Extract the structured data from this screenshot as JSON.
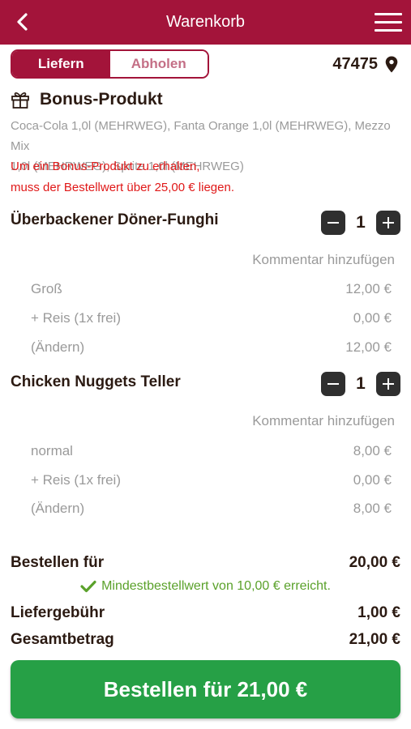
{
  "header": {
    "title": "Warenkorb"
  },
  "tabs": {
    "deliver": "Liefern",
    "pickup": "Abholen"
  },
  "location": {
    "zip": "47475"
  },
  "bonus": {
    "title": "Bonus-Produkt",
    "products_line1": "Coca-Cola 1,0l (MEHRWEG), Fanta Orange 1,0l (MEHRWEG), Mezzo Mix",
    "products_line2": "1,0l (MEHRWEG), Sprite 1,0l (MEHRWEG)",
    "note_line1": "Um ein Bonus-Produkt zu erhalten,",
    "note_line2": "muss der Bestellwert über 25,00 € liegen."
  },
  "items": [
    {
      "name": "Überbackener Döner-Funghi",
      "quantity": "1",
      "comment": "Kommentar hinzufügen",
      "rows": [
        {
          "label": "Groß",
          "price": "12,00 €"
        },
        {
          "label": "+ Reis (1x frei)",
          "price": "0,00 €"
        },
        {
          "label": "(Ändern)",
          "price": "12,00 €"
        }
      ]
    },
    {
      "name": "Chicken Nuggets Teller",
      "quantity": "1",
      "comment": "Kommentar hinzufügen",
      "rows": [
        {
          "label": "normal",
          "price": "8,00 €"
        },
        {
          "label": "+ Reis (1x frei)",
          "price": "0,00 €"
        },
        {
          "label": "(Ändern)",
          "price": "8,00 €"
        }
      ]
    }
  ],
  "summary": {
    "subtotal_label": "Bestellen für",
    "subtotal_value": "20,00 €",
    "min_order_note": "Mindestbestellwert von 10,00 € erreicht.",
    "delivery_label": "Liefergebühr",
    "delivery_value": "1,00 €",
    "total_label": "Gesamtbetrag",
    "total_value": "21,00 €"
  },
  "order_button": {
    "label": "Bestellen für 21,00 €"
  },
  "colors": {
    "brand": "#a3143a",
    "action": "#26a046",
    "success": "#5aa12a",
    "warning": "#e01818"
  },
  "icons": {
    "back": "chevron-left-icon",
    "menu": "hamburger-menu-icon",
    "location": "map-pin-icon",
    "bonus": "gift-icon",
    "check": "checkmark-icon",
    "minus": "minus-icon",
    "plus": "plus-icon"
  }
}
